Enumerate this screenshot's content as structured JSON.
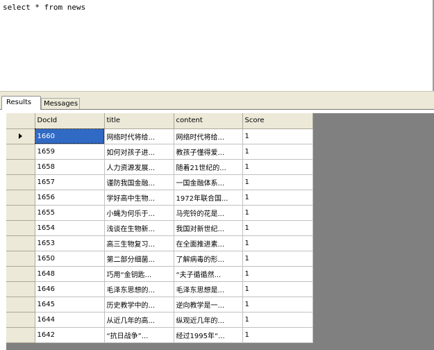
{
  "editor": {
    "query": "select * from news"
  },
  "tabs": {
    "results": "Results",
    "messages": "Messages"
  },
  "grid": {
    "columns": [
      "DocId",
      "title",
      "content",
      "Score"
    ],
    "rows": [
      [
        "1660",
        "网络时代将给...",
        "网络时代将给...",
        "1"
      ],
      [
        "1659",
        "如何对孩子进...",
        "教孩子懂得爱...",
        "1"
      ],
      [
        "1658",
        "人力资源发展...",
        "随着21世纪的...",
        "1"
      ],
      [
        "1657",
        "谨防我国金融...",
        "一国金融体系...",
        "1"
      ],
      [
        "1656",
        "学好高中生物...",
        "1972年联合国...",
        "1"
      ],
      [
        "1655",
        "小蝇为何乐于...",
        "马兜铃的花是...",
        "1"
      ],
      [
        "1654",
        "浅谈在生物新...",
        "我国对新世纪...",
        "1"
      ],
      [
        "1653",
        "高三生物复习...",
        "在全面推进素...",
        "1"
      ],
      [
        "1650",
        "第二部分细菌...",
        "了解病毒的形...",
        "1"
      ],
      [
        "1648",
        "巧用“金钥匙...",
        "“夫子循循然...",
        "1"
      ],
      [
        "1646",
        "毛泽东思想的...",
        "毛泽东思想是...",
        "1"
      ],
      [
        "1645",
        "历史教学中的...",
        "逆向教学是一...",
        "1"
      ],
      [
        "1644",
        "从近几年的高...",
        "纵观近几年的...",
        "1"
      ],
      [
        "1642",
        "“抗日战争”...",
        "经过1995年“...",
        "1"
      ]
    ],
    "selected_row": 0
  },
  "colors": {
    "selection": "#316ac5",
    "grid_background": "#808080",
    "chrome": "#ece9d8"
  }
}
